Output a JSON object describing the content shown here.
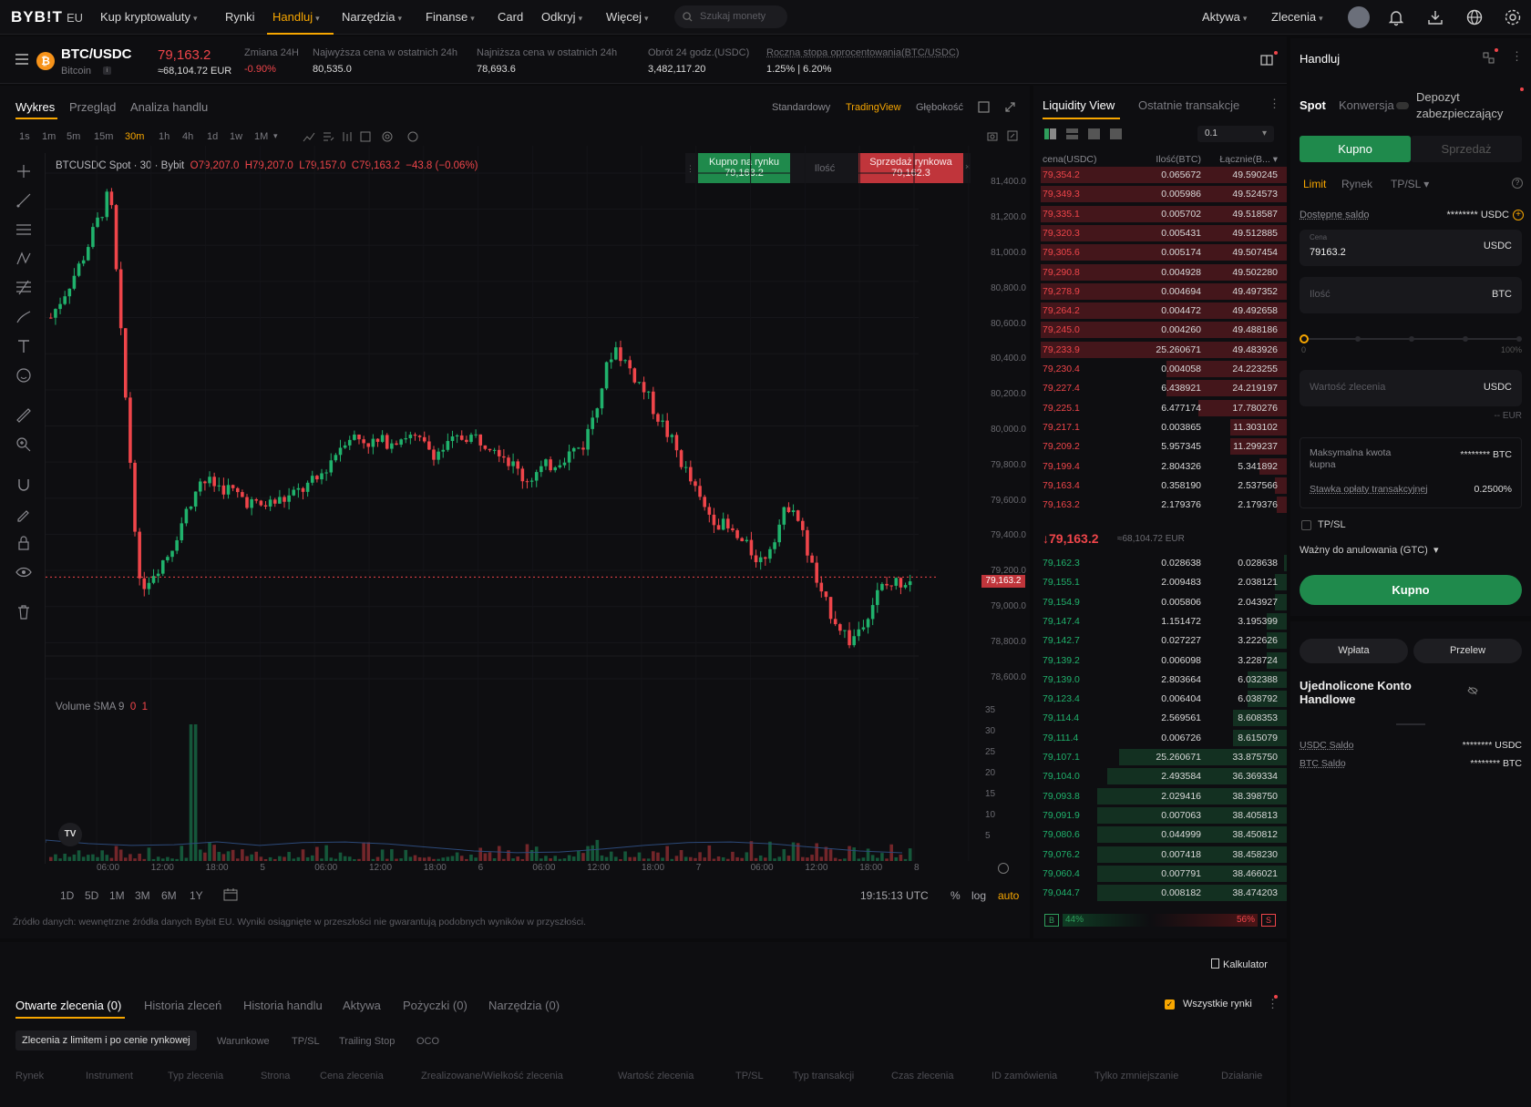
{
  "nav": {
    "logo": "BYB!T",
    "logo_suffix": "EU",
    "items": [
      "Kup kryptowaluty",
      "Rynki",
      "Handluj",
      "Narzędzia",
      "Finanse",
      "Card",
      "Odkryj",
      "Więcej"
    ],
    "active": "Handluj",
    "search_placeholder": "Szukaj monety",
    "assets": "Aktywa",
    "orders": "Zlecenia"
  },
  "ticker": {
    "pair": "BTC/USDC",
    "name": "Bitcoin",
    "price": "79,163.2",
    "price_eur": "≈68,104.72 EUR",
    "change_label": "Zmiana 24H",
    "change_value": "-0.90%",
    "high_label": "Najwyższa cena w ostatnich 24h",
    "high_value": "80,535.0",
    "low_label": "Najniższa cena w ostatnich 24h",
    "low_value": "78,693.6",
    "turnover_label": "Obrót 24 godz.(USDC)",
    "turnover_value": "3,482,117.20",
    "apr_label": "Roczna stopa oprocentowania(BTC/USDC)",
    "apr_value": "1.25% | 6.20%"
  },
  "chart_tabs": {
    "chart": "Wykres",
    "overview": "Przegląd",
    "analysis": "Analiza handlu",
    "standard": "Standardowy",
    "tradingview": "TradingView",
    "depth": "Głębokość"
  },
  "timeframes": [
    "1s",
    "1m",
    "5m",
    "15m",
    "30m",
    "1h",
    "4h",
    "1d",
    "1w",
    "1M"
  ],
  "active_timeframe": "30m",
  "chart_header": {
    "symbol": "BTCUSDC Spot · 30 · Bybit",
    "o": "O79,207.0",
    "h": "H79,207.0",
    "l": "L79,157.0",
    "c": "C79,163.2",
    "chg": "−43.8 (−0.06%)",
    "buy_label": "Kupno na rynku",
    "buy_price": "79,163.2",
    "qty_label": "Ilość",
    "sell_label": "Sprzedaż rynkowa",
    "sell_price": "79,162.3",
    "volume_label": "Volume SMA 9",
    "volume_v1": "0",
    "volume_v2": "1"
  },
  "price_axis": [
    "81,400.0",
    "81,200.0",
    "81,000.0",
    "80,800.0",
    "80,600.0",
    "80,400.0",
    "80,200.0",
    "80,000.0",
    "79,800.0",
    "79,600.0",
    "79,400.0",
    "79,200.0",
    "79,000.0",
    "78,800.0",
    "78,600.0"
  ],
  "current_price_tag": "79,163.2",
  "volume_axis": [
    "35",
    "30",
    "25",
    "20",
    "15",
    "10",
    "5"
  ],
  "time_axis": [
    "06:00",
    "12:00",
    "18:00",
    "5",
    "06:00",
    "12:00",
    "18:00",
    "6",
    "06:00",
    "12:00",
    "18:00",
    "7",
    "06:00",
    "12:00",
    "18:00",
    "8"
  ],
  "ranges": [
    "1D",
    "5D",
    "1M",
    "3M",
    "6M",
    "1Y"
  ],
  "chart_footer": {
    "time": "19:15:13 UTC",
    "pct": "%",
    "log": "log",
    "auto": "auto",
    "disclaimer": "Źródło danych: wewnętrzne źródła danych Bybit EU. Wyniki osiągnięte w przeszłości nie gwarantują podobnych wyników w przyszłości."
  },
  "chart_data": {
    "type": "candlestick",
    "symbol": "BTCUSDC",
    "interval": "30m",
    "ylim": [
      78600,
      81400
    ],
    "approx_path_close": [
      80600,
      80900,
      81300,
      79100,
      79300,
      79700,
      79650,
      79550,
      79600,
      79700,
      79950,
      79900,
      79950,
      79850,
      79950,
      79900,
      79700,
      79800,
      79900,
      80450,
      80200,
      79900,
      79550,
      79400,
      79250,
      79600,
      79050,
      78800,
      79100,
      79160
    ],
    "last_price": 79163.2
  },
  "orderbook": {
    "tab_liquidity": "Liquidity View",
    "tab_trades": "Ostatnie transakcje",
    "step": "0.1",
    "col_price": "cena(USDC)",
    "col_qty": "Ilość(BTC)",
    "col_total": "Łącznie(B...",
    "asks": [
      [
        "79,354.2",
        "0.065672",
        "49.590245"
      ],
      [
        "79,349.3",
        "0.005986",
        "49.524573"
      ],
      [
        "79,335.1",
        "0.005702",
        "49.518587"
      ],
      [
        "79,320.3",
        "0.005431",
        "49.512885"
      ],
      [
        "79,305.6",
        "0.005174",
        "49.507454"
      ],
      [
        "79,290.8",
        "0.004928",
        "49.502280"
      ],
      [
        "79,278.9",
        "0.004694",
        "49.497352"
      ],
      [
        "79,264.2",
        "0.004472",
        "49.492658"
      ],
      [
        "79,245.0",
        "0.004260",
        "49.488186"
      ],
      [
        "79,233.9",
        "25.260671",
        "49.483926"
      ],
      [
        "79,230.4",
        "0.004058",
        "24.223255"
      ],
      [
        "79,227.4",
        "6.438921",
        "24.219197"
      ],
      [
        "79,225.1",
        "6.477174",
        "17.780276"
      ],
      [
        "79,217.1",
        "0.003865",
        "11.303102"
      ],
      [
        "79,209.2",
        "5.957345",
        "11.299237"
      ],
      [
        "79,199.4",
        "2.804326",
        "5.341892"
      ],
      [
        "79,163.4",
        "0.358190",
        "2.537566"
      ],
      [
        "79,163.2",
        "2.179376",
        "2.179376"
      ]
    ],
    "ask_fill": [
      1,
      1,
      1,
      1,
      1,
      1,
      1,
      1,
      1,
      1,
      0.49,
      0.49,
      0.36,
      0.23,
      0.23,
      0.11,
      0.05,
      0.04
    ],
    "mid_price": "79,163.2",
    "mid_eur": "≈68,104.72 EUR",
    "bids": [
      [
        "79,162.3",
        "0.028638",
        "0.028638"
      ],
      [
        "79,155.1",
        "2.009483",
        "2.038121"
      ],
      [
        "79,154.9",
        "0.005806",
        "2.043927"
      ],
      [
        "79,147.4",
        "1.151472",
        "3.195399"
      ],
      [
        "79,142.7",
        "0.027227",
        "3.222626"
      ],
      [
        "79,139.2",
        "0.006098",
        "3.228724"
      ],
      [
        "79,139.0",
        "2.803664",
        "6.032388"
      ],
      [
        "79,123.4",
        "0.006404",
        "6.038792"
      ],
      [
        "79,114.4",
        "2.569561",
        "8.608353"
      ],
      [
        "79,111.4",
        "0.006726",
        "8.615079"
      ],
      [
        "79,107.1",
        "25.260671",
        "33.875750"
      ],
      [
        "79,104.0",
        "2.493584",
        "36.369334"
      ],
      [
        "79,093.8",
        "2.029416",
        "38.398750"
      ],
      [
        "79,091.9",
        "0.007063",
        "38.405813"
      ],
      [
        "79,080.6",
        "0.044999",
        "38.450812"
      ],
      [
        "79,076.2",
        "0.007418",
        "38.458230"
      ],
      [
        "79,060.4",
        "0.007791",
        "38.466021"
      ],
      [
        "79,044.7",
        "0.008182",
        "38.474203"
      ]
    ],
    "bid_fill": [
      0.01,
      0.05,
      0.05,
      0.08,
      0.08,
      0.08,
      0.16,
      0.16,
      0.22,
      0.22,
      0.68,
      0.73,
      0.77,
      0.77,
      0.77,
      0.77,
      0.77,
      0.77
    ],
    "buy_pct": "44%",
    "sell_pct": "56%",
    "b": "B",
    "s": "S"
  },
  "trade": {
    "title": "Handluj",
    "spot": "Spot",
    "conversion": "Konwersja",
    "deposit": "Depozyt zabezpieczający",
    "buy": "Kupno",
    "sell": "Sprzedaż",
    "limit": "Limit",
    "market": "Rynek",
    "tpsl": "TP/SL",
    "available_label": "Dostępne saldo",
    "available_value": "******** USDC",
    "price_label": "Cena",
    "price_value": "79163.2",
    "price_unit": "USDC",
    "qty_placeholder": "Ilość",
    "qty_unit": "BTC",
    "slider_min": "0",
    "slider_max": "100%",
    "slider_value": 0,
    "value_placeholder": "Wartość zlecenia",
    "value_unit": "USDC",
    "eur": "-- EUR",
    "max_label": "Maksymalna kwota kupna",
    "max_value": "******** BTC",
    "fee_label": "Stawka opłaty transakcyjnej",
    "fee_value": "0.2500%",
    "tpsl_check": "TP/SL",
    "gtc": "Ważny do anulowania (GTC)",
    "submit": "Kupno",
    "deposit_btn": "Wpłata",
    "transfer_btn": "Przelew",
    "account_title": "Ujednolicone Konto Handlowe",
    "usdc_label": "USDC Saldo",
    "usdc_value": "******** USDC",
    "btc_label": "BTC Saldo",
    "btc_value": "******** BTC"
  },
  "bottom": {
    "calculator": "Kalkulator",
    "tabs": [
      "Otwarte zlecenia (0)",
      "Historia zleceń",
      "Historia handlu",
      "Aktywa",
      "Pożyczki (0)",
      "Narzędzia (0)"
    ],
    "all_markets": "Wszystkie rynki",
    "subtabs": [
      "Zlecenia z limitem i po cenie rynkowej",
      "Warunkowe",
      "TP/SL",
      "Trailing Stop",
      "OCO"
    ],
    "columns": [
      "Rynek",
      "Instrument",
      "Typ zlecenia",
      "Strona",
      "Cena zlecenia",
      "Zrealizowane/Wielkość zlecenia",
      "Wartość zlecenia",
      "TP/SL",
      "Typ transakcji",
      "Czas zlecenia",
      "ID zamówienia",
      "Tylko zmniejszanie",
      "Działanie"
    ]
  },
  "colors": {
    "accent": "#f7a600",
    "up": "#20b26c",
    "down": "#ef454a",
    "buy_button": "#1f8a4c",
    "sell_button": "#c0353b"
  }
}
